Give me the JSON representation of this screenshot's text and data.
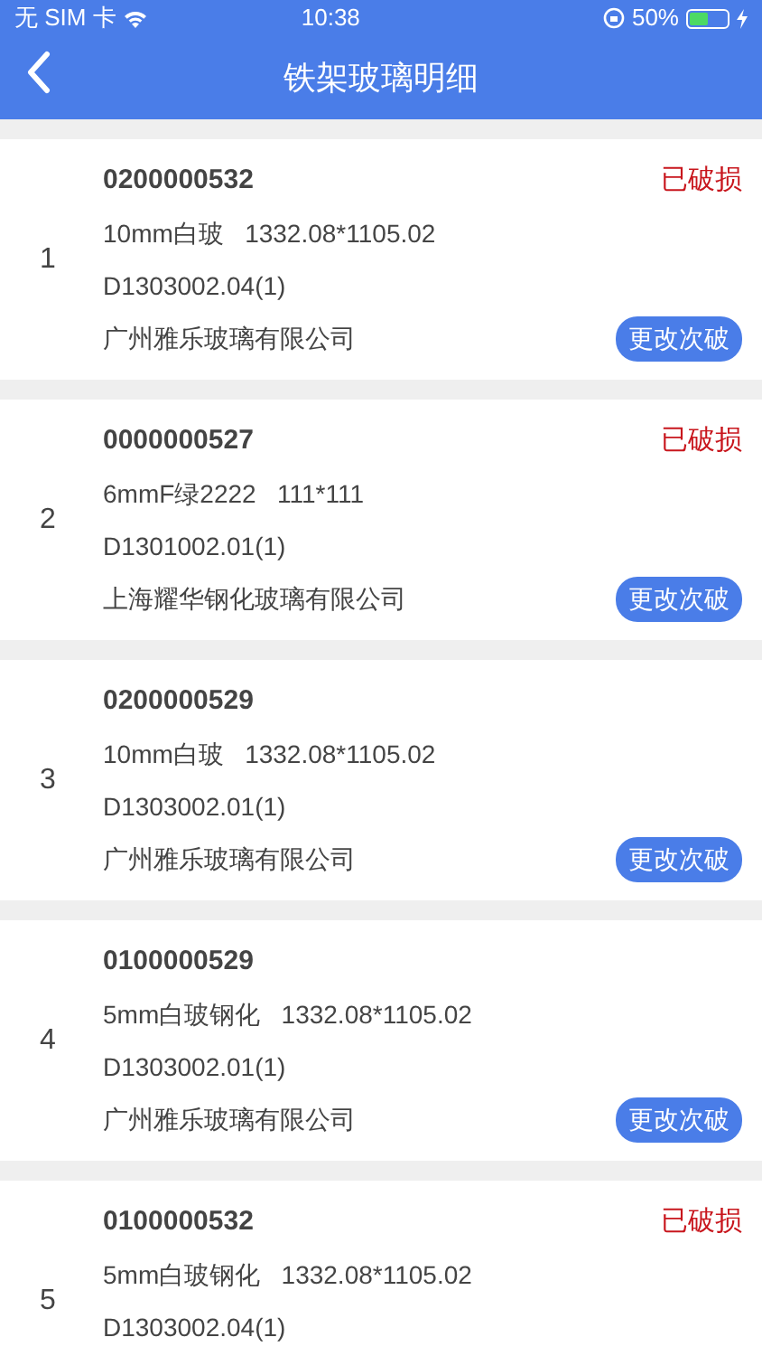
{
  "status_bar": {
    "carrier": "无 SIM 卡",
    "time": "10:38",
    "battery": "50%"
  },
  "nav": {
    "title": "铁架玻璃明细"
  },
  "items": [
    {
      "index": "1",
      "code": "0200000532",
      "material": "10mm白玻",
      "size": "1332.08*1105.02",
      "part": "D1303002.04(1)",
      "company": "广州雅乐玻璃有限公司",
      "status": "已破损",
      "button": "更改次破"
    },
    {
      "index": "2",
      "code": "0000000527",
      "material": "6mmF绿2222",
      "size": "111*111",
      "part": "D1301002.01(1)",
      "company": "上海耀华钢化玻璃有限公司",
      "status": "已破损",
      "button": "更改次破"
    },
    {
      "index": "3",
      "code": "0200000529",
      "material": "10mm白玻",
      "size": "1332.08*1105.02",
      "part": "D1303002.01(1)",
      "company": "广州雅乐玻璃有限公司",
      "button": "更改次破"
    },
    {
      "index": "4",
      "code": "0100000529",
      "material": "5mm白玻钢化",
      "size": "1332.08*1105.02",
      "part": "D1303002.01(1)",
      "company": "广州雅乐玻璃有限公司",
      "button": "更改次破"
    },
    {
      "index": "5",
      "code": "0100000532",
      "material": "5mm白玻钢化",
      "size": "1332.08*1105.02",
      "part": "D1303002.04(1)",
      "status": "已破损"
    }
  ]
}
